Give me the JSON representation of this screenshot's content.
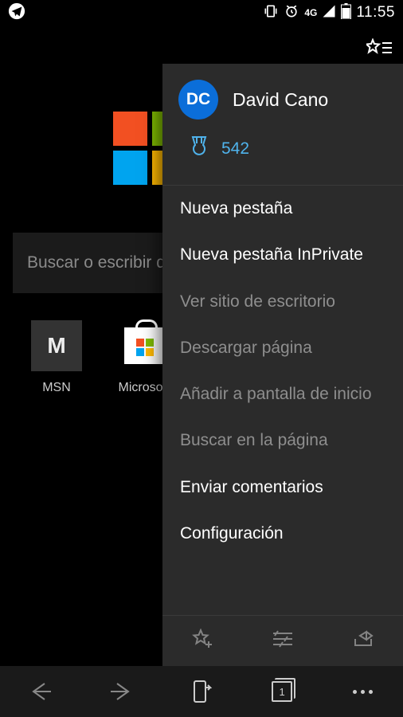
{
  "status": {
    "network_label": "4G",
    "clock": "11:55"
  },
  "ntp": {
    "search_placeholder": "Buscar o escribir dirección web",
    "tiles": [
      {
        "label": "MSN",
        "initial": "M"
      },
      {
        "label": "Microsoft"
      }
    ]
  },
  "menu": {
    "profile": {
      "initials": "DC",
      "name": "David Cano"
    },
    "rewards_points": "542",
    "items": [
      {
        "label": "Nueva pestaña",
        "enabled": true
      },
      {
        "label": "Nueva pestaña InPrivate",
        "enabled": true
      },
      {
        "label": "Ver sitio de escritorio",
        "enabled": false
      },
      {
        "label": "Descargar página",
        "enabled": false
      },
      {
        "label": "Añadir a pantalla de inicio",
        "enabled": false
      },
      {
        "label": "Buscar en la página",
        "enabled": false
      },
      {
        "label": "Enviar comentarios",
        "enabled": true
      },
      {
        "label": "Configuración",
        "enabled": true
      }
    ]
  },
  "bottombar": {
    "tab_count": "1"
  }
}
